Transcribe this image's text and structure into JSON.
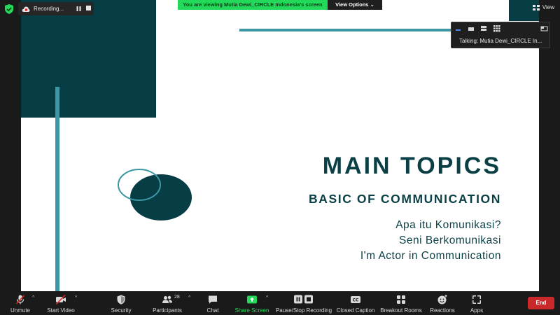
{
  "top": {
    "recording_label": "Recording...",
    "viewing_text": "You are viewing Mutia Dewi_CIRCLE Indonesia's screen",
    "view_options_label": "View Options",
    "view_label": "View"
  },
  "slide": {
    "title": "MAIN TOPICS",
    "subtitle": "BASIC OF COMMUNICATION",
    "items": [
      "Apa itu Komunikasi?",
      "Seni Berkomunikasi",
      "I'm Actor in Communication"
    ]
  },
  "thumbnail": {
    "talking_text": "Talking: Mutia Dewi_CIRCLE In..."
  },
  "toolbar": {
    "unmute": "Unmute",
    "start_video": "Start Video",
    "security": "Security",
    "participants": "Participants",
    "participants_count": "28",
    "chat": "Chat",
    "share_screen": "Share Screen",
    "pause_stop_recording": "Pause/Stop Recording",
    "closed_caption": "Closed Caption",
    "breakout_rooms": "Breakout Rooms",
    "reactions": "Reactions",
    "apps": "Apps",
    "end": "End"
  },
  "colors": {
    "slide_teal_dark": "#073d44",
    "slide_teal_light": "#3c96a3",
    "share_green": "#23d959",
    "end_red": "#c9292b"
  },
  "icons": [
    "shield-icon",
    "recording-cloud-icon",
    "pause-icon",
    "stop-icon",
    "view-grid-icon",
    "mic-muted-icon",
    "video-off-icon",
    "security-shield-icon",
    "participants-icon",
    "chat-icon",
    "share-screen-icon",
    "record-control-icon",
    "cc-icon",
    "breakout-rooms-icon",
    "reactions-icon",
    "apps-icon"
  ]
}
